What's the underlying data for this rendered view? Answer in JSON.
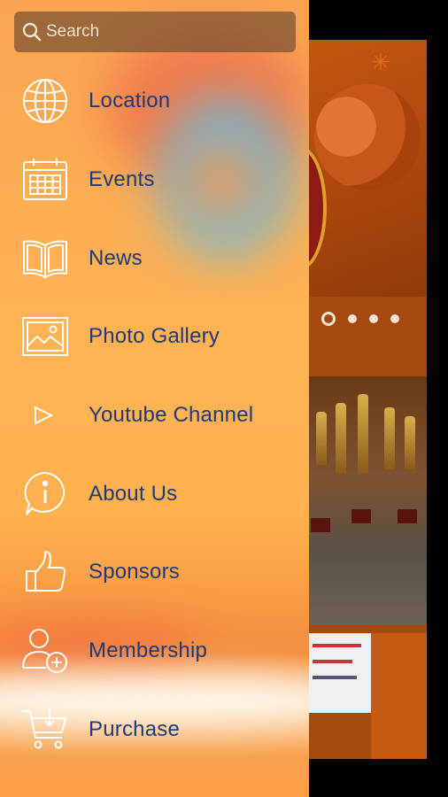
{
  "search": {
    "placeholder": "Search",
    "icon": "search-icon"
  },
  "menu": {
    "items": [
      {
        "label": "Location",
        "icon": "globe-icon"
      },
      {
        "label": "Events",
        "icon": "calendar-icon"
      },
      {
        "label": "News",
        "icon": "book-icon"
      },
      {
        "label": "Photo Gallery",
        "icon": "image-icon"
      },
      {
        "label": "Youtube Channel",
        "icon": "play-icon"
      },
      {
        "label": "About Us",
        "icon": "info-icon"
      },
      {
        "label": "Sponsors",
        "icon": "thumbs-up-icon"
      },
      {
        "label": "Membership",
        "icon": "add-user-icon"
      },
      {
        "label": "Purchase",
        "icon": "cart-icon"
      }
    ]
  },
  "background_app": {
    "carousel_active_index": 1,
    "carousel_count": 4
  },
  "colors": {
    "drawer_bg": "#ffb253",
    "menu_text": "#1f3a78",
    "icon_stroke": "#ffffff",
    "search_bg": "#785232"
  }
}
